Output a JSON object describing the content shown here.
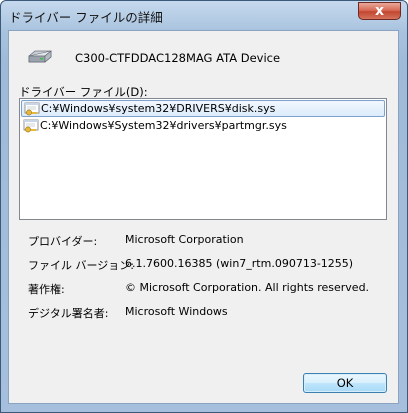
{
  "window": {
    "title": "ドライバー ファイルの詳細",
    "close_label": "x"
  },
  "device": {
    "icon": "drive-icon",
    "name": "C300-CTFDDAC128MAG ATA Device"
  },
  "files": {
    "label": "ドライバー ファイル(D):",
    "items": [
      {
        "icon": "driver-file-icon",
        "path": "C:¥Windows¥system32¥DRIVERS¥disk.sys",
        "selected": true
      },
      {
        "icon": "driver-file-icon",
        "path": "C:¥Windows¥System32¥drivers¥partmgr.sys",
        "selected": false
      }
    ]
  },
  "details": {
    "provider_label": "プロバイダー:",
    "provider_value": "Microsoft Corporation",
    "version_label": "ファイル バージョン:",
    "version_value": "6.1.7600.16385 (win7_rtm.090713-1255)",
    "copyright_label": "著作権:",
    "copyright_value": "© Microsoft Corporation. All rights reserved.",
    "signer_label": "デジタル署名者:",
    "signer_value": "Microsoft Windows"
  },
  "buttons": {
    "ok_label": "OK"
  },
  "colors": {
    "selection_border": "#7da2ce",
    "close_button": "#c24732",
    "ok_button_border": "#3c7fb1"
  }
}
